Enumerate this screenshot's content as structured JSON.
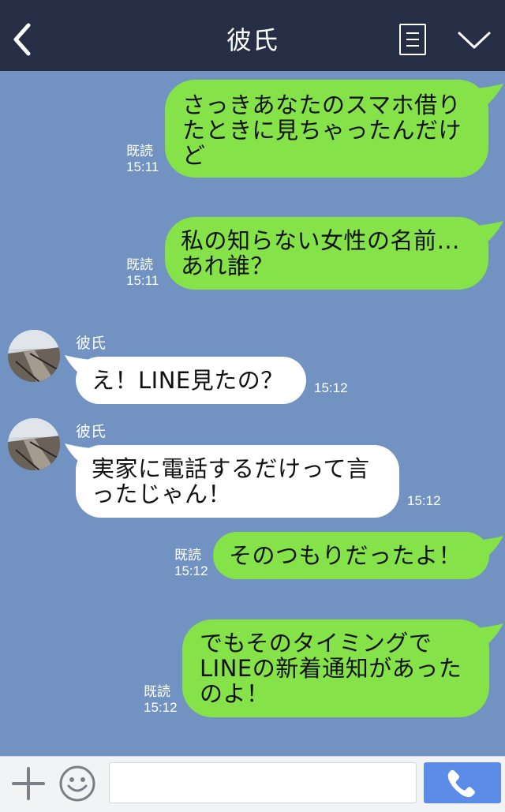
{
  "header": {
    "title": "彼氏",
    "back_icon": "chevron-left-icon",
    "menu_icon": "menu-icon",
    "collapse_icon": "chevron-down-icon"
  },
  "messages": [
    {
      "side": "me",
      "text": "さっきあなたのスマホ借りたときに見ちゃったんだけど",
      "read": "既読",
      "time": "15:11"
    },
    {
      "side": "me",
      "text": "私の知らない女性の名前…あれ誰？",
      "read": "既読",
      "time": "15:11"
    },
    {
      "side": "them",
      "sender": "彼氏",
      "text": "え！LINE見たの？",
      "time": "15:12"
    },
    {
      "side": "them",
      "sender": "彼氏",
      "text": "実家に電話するだけって言ったじゃん！",
      "time": "15:12"
    },
    {
      "side": "me",
      "text": "そのつもりだったよ！",
      "read": "既読",
      "time": "15:12"
    },
    {
      "side": "me",
      "text": "でもそのタイミングでLINEの新着通知があったのよ！",
      "read": "既読",
      "time": "15:12"
    }
  ],
  "input_bar": {
    "placeholder": "",
    "plus_icon": "plus-icon",
    "emoji_icon": "emoji-icon",
    "call_icon": "phone-icon"
  },
  "colors": {
    "header_bg": "#252e45",
    "chat_bg": "#7293c1",
    "my_bubble": "#85e249",
    "their_bubble": "#ffffff",
    "call_button": "#5b8de8"
  }
}
